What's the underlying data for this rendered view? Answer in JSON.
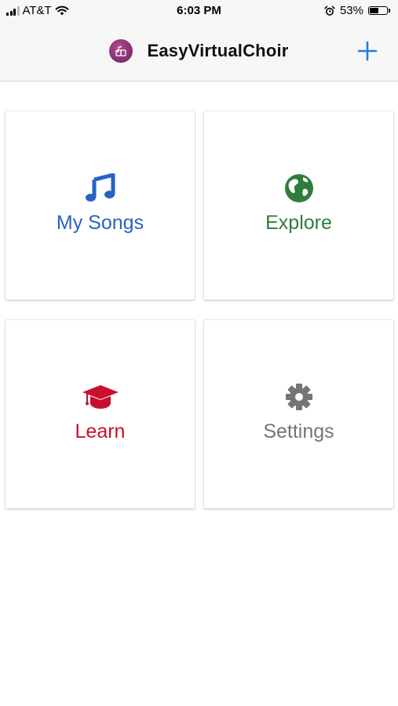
{
  "status_bar": {
    "carrier": "AT&T",
    "time": "6:03 PM",
    "battery_percent": "53%",
    "battery_level": 0.53,
    "icons": [
      "signal-icon",
      "wifi-icon",
      "alarm-icon",
      "battery-icon"
    ]
  },
  "nav": {
    "title": "EasyVirtualChoir",
    "logo_icon": "app-logo-icon",
    "add_icon": "plus-icon",
    "accent_color": "#1a7fe8"
  },
  "tiles": [
    {
      "label": "My Songs",
      "icon": "music-note-icon",
      "color": "#2563c4"
    },
    {
      "label": "Explore",
      "icon": "globe-icon",
      "color": "#2e7d3c"
    },
    {
      "label": "Learn",
      "icon": "graduation-cap-icon",
      "color": "#c8102e"
    },
    {
      "label": "Settings",
      "icon": "gear-icon",
      "color": "#757575"
    }
  ]
}
